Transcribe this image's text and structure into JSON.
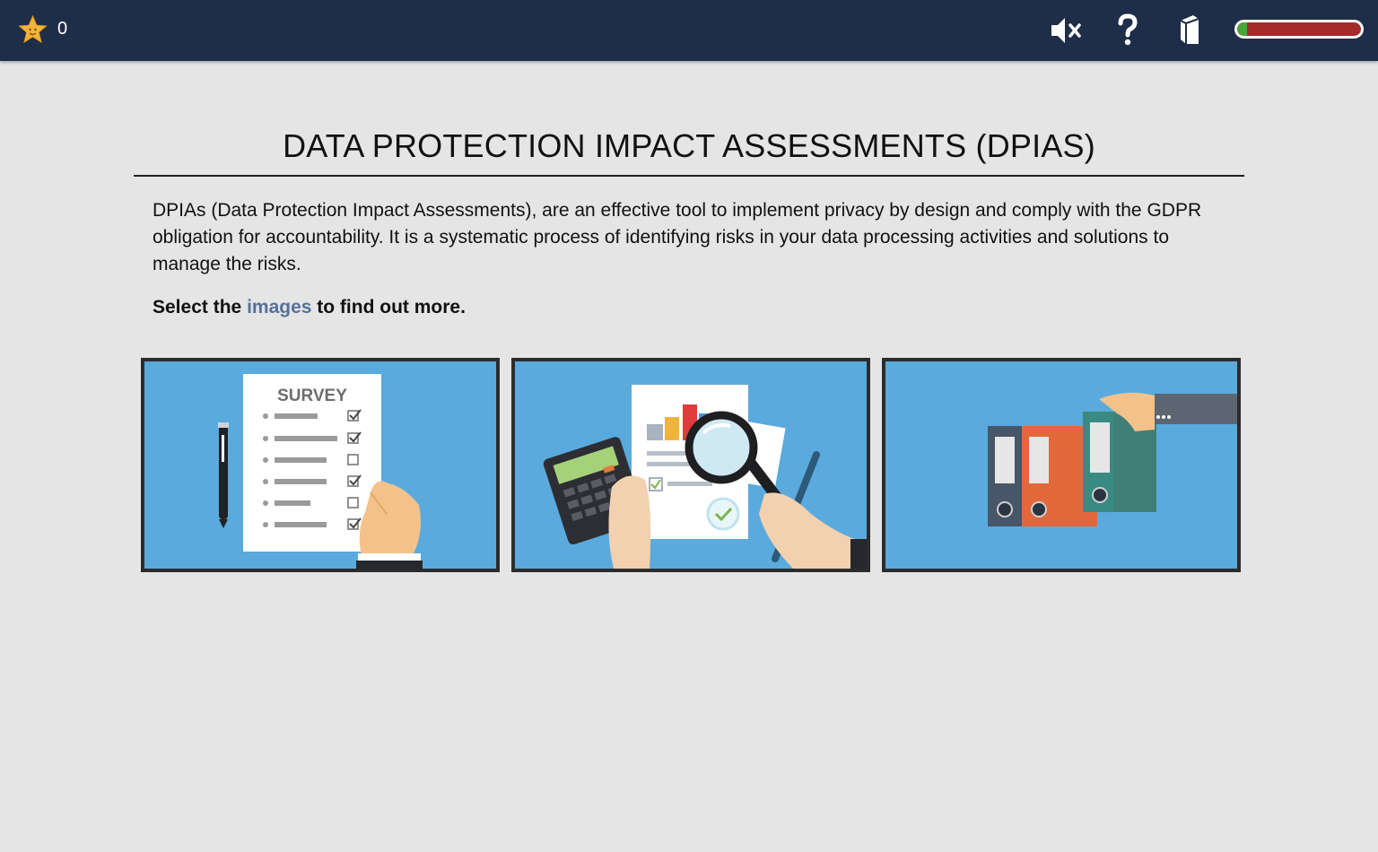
{
  "header": {
    "score": "0",
    "icons": [
      "star-icon",
      "mute-icon",
      "help-icon",
      "glossary-icon"
    ],
    "progress_percent": 8,
    "colors": {
      "bar": "#1e2d48",
      "progress_done": "#46a83a",
      "progress_remaining": "#a52a2a"
    }
  },
  "main": {
    "title": "DATA PROTECTION IMPACT ASSESSMENTS (DPIAS)",
    "intro": "DPIAs (Data Protection Impact Assessments), are an effective tool to implement privacy by design and comply with the GDPR obligation for accountability. It is a systematic process of identifying risks in your data processing activities and solutions to manage the risks.",
    "instruction_before": "Select the",
    "instruction_highlight": "images",
    "instruction_after": "to find out more.",
    "accent_color": "#55709a"
  },
  "cards": [
    {
      "image": "survey-checklist-image",
      "text": "SURVEY"
    },
    {
      "image": "analysis-magnifier-image"
    },
    {
      "image": "binders-files-image"
    }
  ]
}
